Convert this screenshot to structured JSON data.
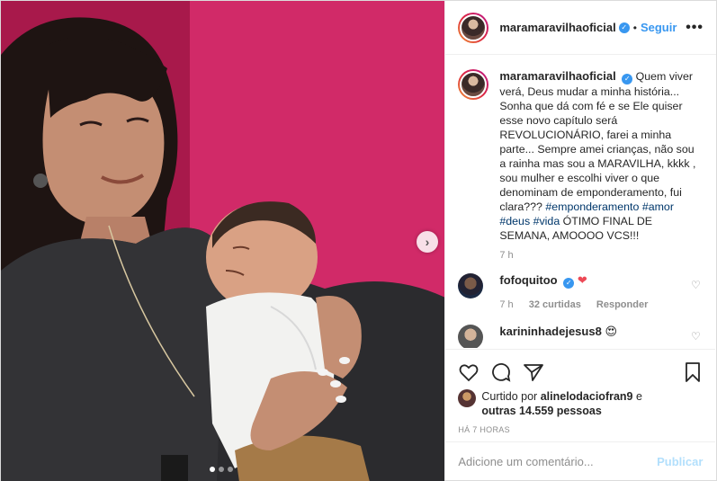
{
  "header": {
    "username": "maramaravilhaoficial",
    "follow_label": "Seguir",
    "more_label": "•••"
  },
  "caption": {
    "username": "maramaravilhaoficial",
    "text_part1": "Quem viver verá, Deus mudar a minha história... Sonha que dá com fé e se Ele quiser esse novo capítulo será REVOLUCIONÁRIO, farei a minha parte... Sempre amei crianças, não sou a rainha mas sou a MARAVILHA, kkkk , sou mulher e escolhi viver o que denominam de emponderamento, fui clara??? ",
    "hashtag1": "#emponderamento",
    "hashtag2": "#amor",
    "hashtag3": "#deus",
    "hashtag4": "#vida",
    "text_part2": "ÓTIMO FINAL DE SEMANA, AMOOOO VCS!!!",
    "time": "7 h"
  },
  "comments": [
    {
      "username": "fofoquitoo",
      "text": "❤",
      "time": "7 h",
      "likes": "32 curtidas",
      "reply_label": "Responder"
    },
    {
      "username": "karininhadejesus8",
      "text": "😍"
    }
  ],
  "likes": {
    "prefix": "Curtido por",
    "user": "alinelodaciofran9",
    "suffix_connector": "e",
    "others": "outras 14.559 pessoas"
  },
  "timestamp": "HÁ 7 HORAS",
  "add_comment": {
    "placeholder": "Adicione um comentário...",
    "publish_label": "Publicar"
  },
  "carousel": {
    "current_slide": 1,
    "total_slides": 3
  }
}
